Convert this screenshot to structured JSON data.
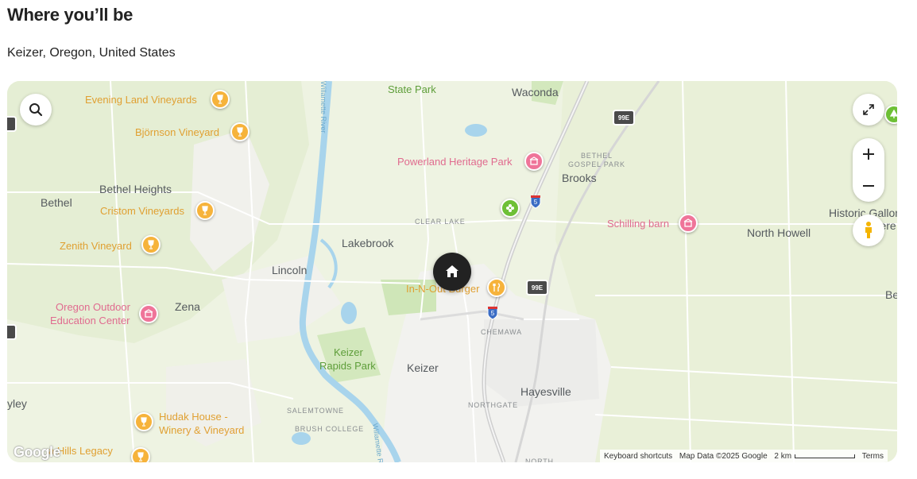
{
  "page": {
    "heading": "Where you’ll be",
    "location": "Keizer, Oregon, United States"
  },
  "map": {
    "places": {
      "state_park": "State Park",
      "waconda": "Waconda",
      "evening_land": "Evening Land Vineyards",
      "bjornson": "Björnson Vineyard",
      "powerland": "Powerland Heritage Park",
      "bethel_gospel_1": "BETHEL",
      "bethel_gospel_2": "GOSPEL PARK",
      "brooks": "Brooks",
      "bethel_heights": "Bethel Heights",
      "bethel": "Bethel",
      "cristom": "Cristom Vineyards",
      "clear_lake": "CLEAR LAKE",
      "schilling": "Schilling barn",
      "historic_gallon": "Historic Gallon",
      "reere": "reere",
      "north_howell": "North Howell",
      "zenith": "Zenith Vineyard",
      "lakebrook": "Lakebrook",
      "lincoln": "Lincoln",
      "in_n_out": "In-N-Out Burger",
      "oregon_outdoor_1": "Oregon Outdoor",
      "oregon_outdoor_2": "Education Center",
      "zena": "Zena",
      "chemawa": "CHEMAWA",
      "be": "Be",
      "keizer_rapids_1": "Keizer",
      "keizer_rapids_2": "Rapids Park",
      "keizer": "Keizer",
      "hayesville": "Hayesville",
      "northgate": "NORTHGATE",
      "yley": "yley",
      "salemtowne": "SALEMTOWNE",
      "hudak_1": "Hudak House -",
      "hudak_2": "Winery & Vineyard",
      "brush_college": "BRUSH COLLEGE",
      "hills_legacy": "a Hills Legacy",
      "north": "NORTH",
      "willamette": "Willamette River"
    },
    "highway": {
      "i5": "5",
      "hwy99e": "99E"
    },
    "controls": {
      "search_icon": "search-icon",
      "fullscreen_icon": "expand-icon",
      "zoom_in_icon": "plus-icon",
      "zoom_out_icon": "minus-icon",
      "pegman_icon": "pegman-icon"
    },
    "attribution": {
      "logo": "Google",
      "keyboard": "Keyboard shortcuts",
      "map_data": "Map Data ©2025 Google",
      "scale": "2 km",
      "terms": "Terms"
    },
    "colors": {
      "land": "#eef3e2",
      "urban": "#f1f1ef",
      "water": "#a8d4ec",
      "park": "#d3e8bd",
      "road": "#ffffff",
      "highway": "#c8c8c8",
      "vineyard_pin": "#f6b33b",
      "poi_pin": "#ef7499",
      "park_pin": "#6ec036",
      "home_marker": "#222222"
    }
  }
}
